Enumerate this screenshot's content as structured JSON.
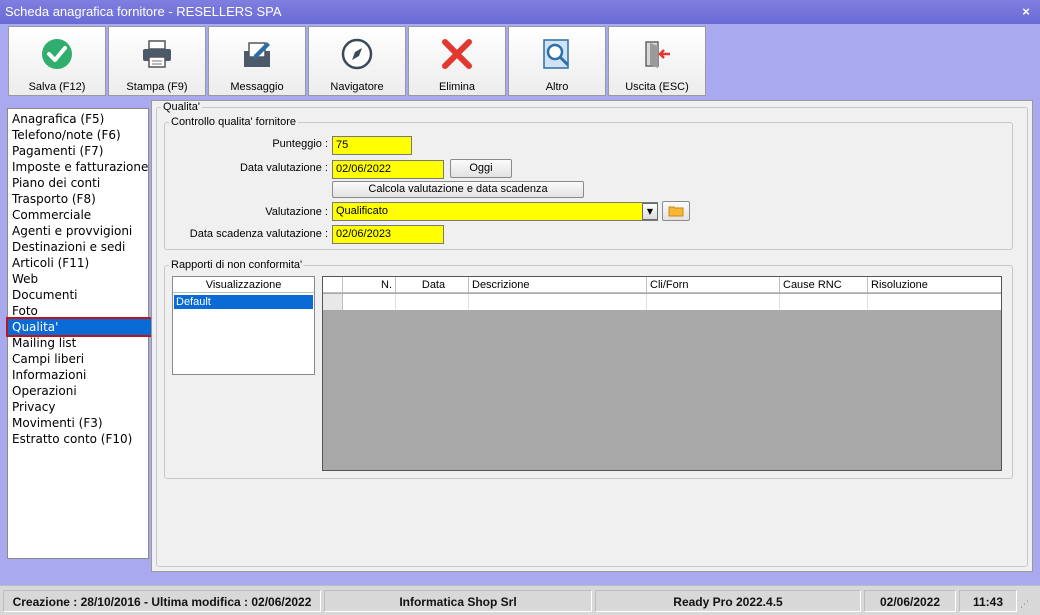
{
  "window": {
    "title": "Scheda anagrafica fornitore - RESELLERS SPA",
    "close": "×"
  },
  "toolbar": [
    {
      "label": "Salva (F12)",
      "icon": "check-circle-icon"
    },
    {
      "label": "Stampa (F9)",
      "icon": "printer-icon"
    },
    {
      "label": "Messaggio",
      "icon": "message-icon"
    },
    {
      "label": "Navigatore",
      "icon": "compass-icon"
    },
    {
      "label": "Elimina",
      "icon": "delete-x-icon"
    },
    {
      "label": "Altro",
      "icon": "search-document-icon"
    },
    {
      "label": "Uscita (ESC)",
      "icon": "exit-door-icon"
    }
  ],
  "nav": {
    "items": [
      "Anagrafica (F5)",
      "Telefono/note (F6)",
      "Pagamenti (F7)",
      "Imposte e fatturazione",
      "Piano dei conti",
      "Trasporto (F8)",
      "Commerciale",
      "Agenti e provvigioni",
      "Destinazioni e sedi",
      "Articoli (F11)",
      "Web",
      "Documenti",
      "Foto",
      "Qualita'",
      "Mailing list",
      "Campi liberi",
      "Informazioni",
      "Operazioni",
      "Privacy",
      "Movimenti (F3)",
      "Estratto conto (F10)"
    ],
    "selected": "Qualita'"
  },
  "quality": {
    "group_title": "Qualita'",
    "control_title": "Controllo qualita' fornitore",
    "score_label": "Punteggio :",
    "score_value": "75",
    "eval_date_label": "Data valutazione :",
    "eval_date_value": "02/06/2022",
    "today_button": "Oggi",
    "calc_button": "Calcola valutazione e data scadenza",
    "evaluation_label": "Valutazione :",
    "evaluation_value": "Qualificato",
    "expiry_label": "Data scadenza valutazione :",
    "expiry_value": "02/06/2023"
  },
  "nonconformity": {
    "title": "Rapporti di non conformita'",
    "view_header": "Visualizzazione",
    "views": [
      "Default"
    ],
    "columns": [
      "N.",
      "Data",
      "Descrizione",
      "Cli/Forn",
      "Cause RNC",
      "Risoluzione"
    ]
  },
  "status": {
    "created": "Creazione : 28/10/2016 - Ultima modifica : 02/06/2022",
    "company": "Informatica Shop Srl",
    "version": "Ready Pro 2022.4.5",
    "date": "02/06/2022",
    "time": "11:43"
  },
  "colors": {
    "highlight_yellow": "#ffff00",
    "selection_blue": "#0a6ad6",
    "selection_border": "#c0141b"
  }
}
